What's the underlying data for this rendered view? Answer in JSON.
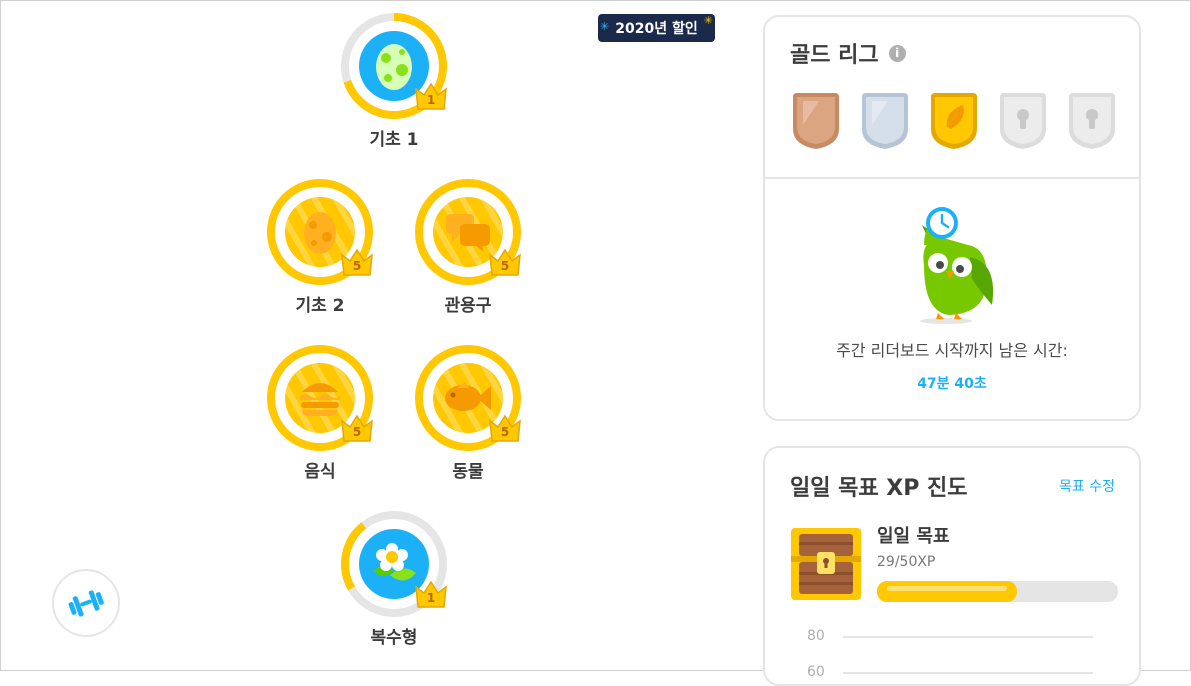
{
  "promo": {
    "label": "2020년 할인"
  },
  "skills": [
    {
      "label": "기초 1",
      "level": "1"
    },
    {
      "label": "기초 2",
      "level": "5"
    },
    {
      "label": "관용구",
      "level": "5"
    },
    {
      "label": "음식",
      "level": "5"
    },
    {
      "label": "동물",
      "level": "5"
    },
    {
      "label": "복수형",
      "level": "1"
    }
  ],
  "league": {
    "title": "골드 리그",
    "info": "i",
    "countdown_label": "주간 리더보드 시작까지 남은 시간:",
    "countdown_value": "47분 40초"
  },
  "daily_goal": {
    "title": "일일 목표 XP 진도",
    "edit_label": "목표 수정",
    "goal_name": "일일 목표",
    "progress_text": "29/50XP",
    "progress_fraction": 0.58,
    "chart_ticks": [
      "80",
      "60"
    ]
  },
  "colors": {
    "gold": "#ffc800",
    "blue": "#1cb0f6",
    "gray": "#e5e5e5",
    "owl_green": "#78c800"
  }
}
